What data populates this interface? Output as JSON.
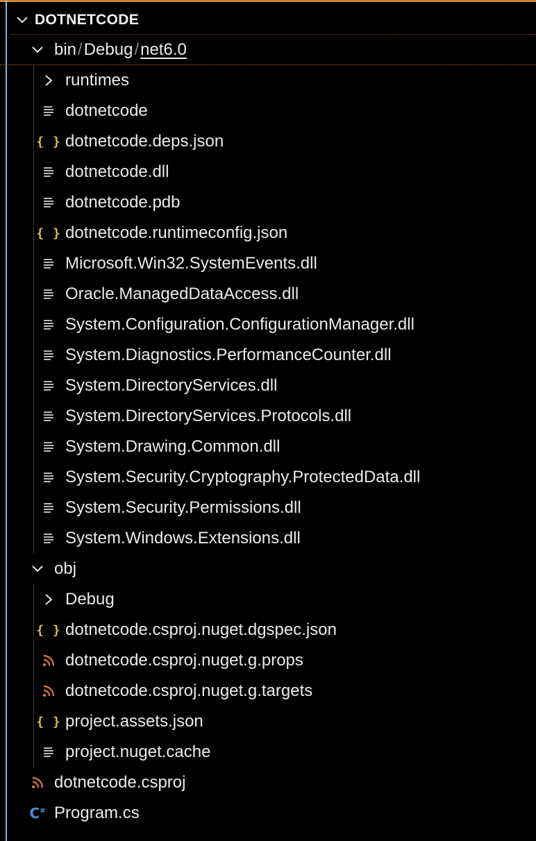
{
  "explorer": {
    "section_title": "DOTNETCODE",
    "breadcrumb": {
      "parts": [
        "bin",
        "Debug",
        "net6.0"
      ],
      "separator": "/"
    },
    "bin_items": [
      {
        "label": "runtimes",
        "icon": "chevron-right-icon"
      },
      {
        "label": "dotnetcode",
        "icon": "file-lines-icon"
      },
      {
        "label": "dotnetcode.deps.json",
        "icon": "json-braces-icon"
      },
      {
        "label": "dotnetcode.dll",
        "icon": "file-lines-icon"
      },
      {
        "label": "dotnetcode.pdb",
        "icon": "file-lines-icon"
      },
      {
        "label": "dotnetcode.runtimeconfig.json",
        "icon": "json-braces-icon"
      },
      {
        "label": "Microsoft.Win32.SystemEvents.dll",
        "icon": "file-lines-icon"
      },
      {
        "label": "Oracle.ManagedDataAccess.dll",
        "icon": "file-lines-icon"
      },
      {
        "label": "System.Configuration.ConfigurationManager.dll",
        "icon": "file-lines-icon"
      },
      {
        "label": "System.Diagnostics.PerformanceCounter.dll",
        "icon": "file-lines-icon"
      },
      {
        "label": "System.DirectoryServices.dll",
        "icon": "file-lines-icon"
      },
      {
        "label": "System.DirectoryServices.Protocols.dll",
        "icon": "file-lines-icon"
      },
      {
        "label": "System.Drawing.Common.dll",
        "icon": "file-lines-icon"
      },
      {
        "label": "System.Security.Cryptography.ProtectedData.dll",
        "icon": "file-lines-icon"
      },
      {
        "label": "System.Security.Permissions.dll",
        "icon": "file-lines-icon"
      },
      {
        "label": "System.Windows.Extensions.dll",
        "icon": "file-lines-icon"
      }
    ],
    "obj_folder": {
      "label": "obj",
      "icon": "chevron-down-icon"
    },
    "obj_items": [
      {
        "label": "Debug",
        "icon": "chevron-right-icon"
      },
      {
        "label": "dotnetcode.csproj.nuget.dgspec.json",
        "icon": "json-braces-icon"
      },
      {
        "label": "dotnetcode.csproj.nuget.g.props",
        "icon": "rss-icon"
      },
      {
        "label": "dotnetcode.csproj.nuget.g.targets",
        "icon": "rss-icon"
      },
      {
        "label": "project.assets.json",
        "icon": "json-braces-icon"
      },
      {
        "label": "project.nuget.cache",
        "icon": "file-lines-icon"
      }
    ],
    "root_files": [
      {
        "label": "dotnetcode.csproj",
        "icon": "rss-icon"
      },
      {
        "label": "Program.cs",
        "icon": "csharp-icon"
      }
    ]
  },
  "colors": {
    "background": "#000000",
    "text": "#eaeaea",
    "json_icon": "#d6c24a",
    "rss_icon": "#e07b39",
    "csharp_icon": "#4a8fd6",
    "focus_border": "#c8862e"
  }
}
